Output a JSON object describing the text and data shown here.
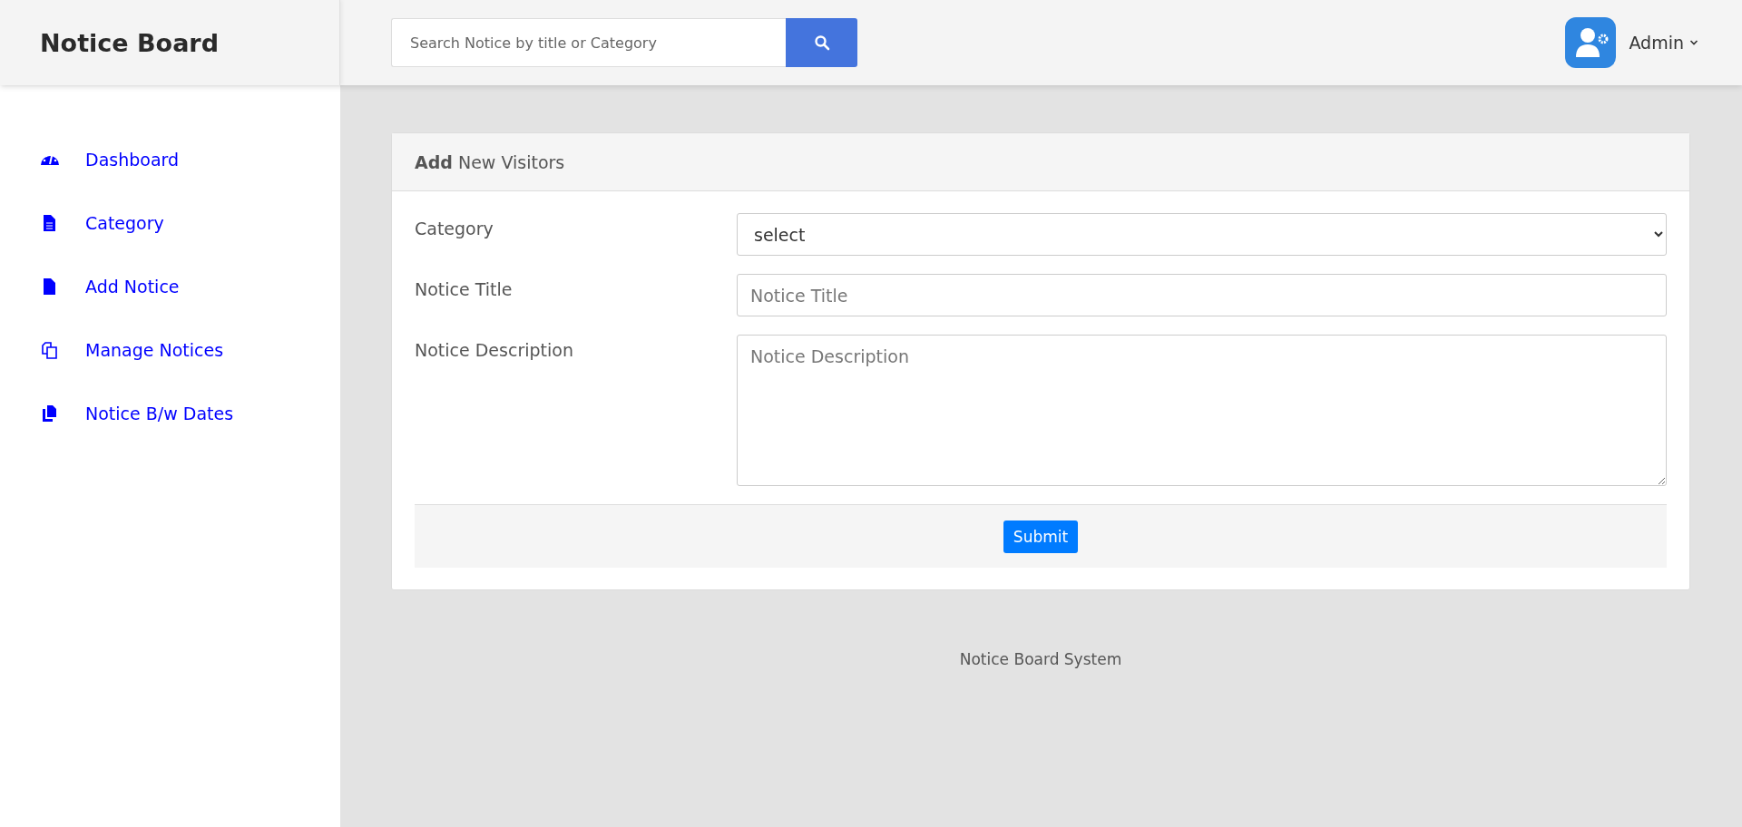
{
  "brand": "Notice Board",
  "search": {
    "placeholder": "Search Notice by title or Category"
  },
  "user": {
    "name": "Admin"
  },
  "sidebar": {
    "items": [
      {
        "label": "Dashboard",
        "kind": "gauge"
      },
      {
        "label": "Category",
        "kind": "doc-lines"
      },
      {
        "label": "Add Notice",
        "kind": "doc"
      },
      {
        "label": "Manage Notices",
        "kind": "copy-outline"
      },
      {
        "label": "Notice B/w Dates",
        "kind": "copy"
      }
    ]
  },
  "card": {
    "title_bold": "Add",
    "title_rest": "New Visitors",
    "fields": [
      {
        "label": "Category",
        "kind": "select",
        "value": "select"
      },
      {
        "label": "Notice Title",
        "kind": "input",
        "placeholder": "Notice Title"
      },
      {
        "label": "Notice Description",
        "kind": "textarea",
        "placeholder": "Notice Description"
      }
    ],
    "submit": "Submit"
  },
  "footer": "Notice Board System"
}
